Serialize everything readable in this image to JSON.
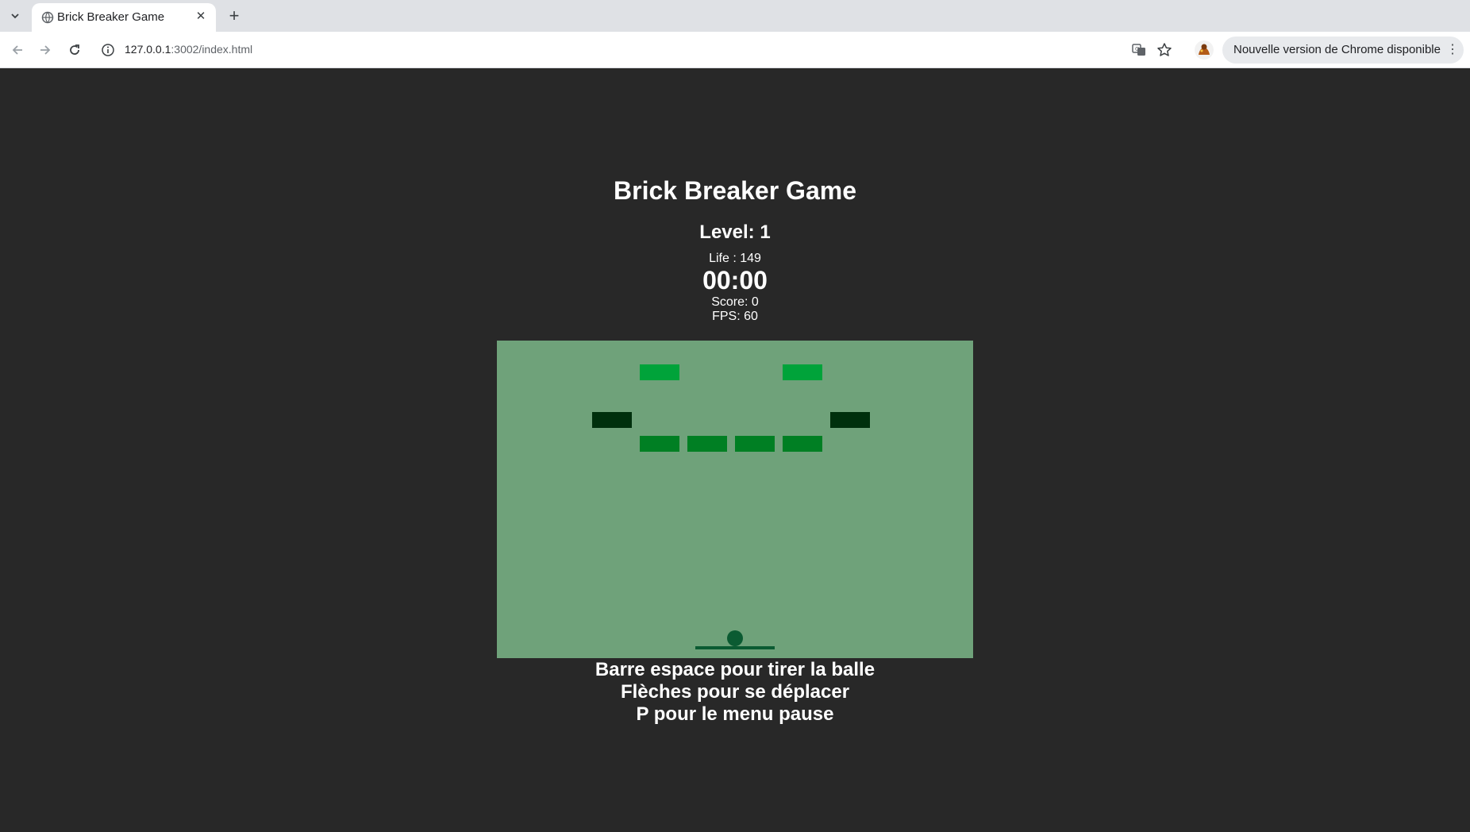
{
  "browser": {
    "tab_title": "Brick Breaker Game",
    "url_host": "127.0.0.1",
    "url_rest": ":3002/index.html",
    "update_label": "Nouvelle version de Chrome disponible"
  },
  "game": {
    "title": "Brick Breaker Game",
    "level": "Level: 1",
    "life": "Life : 149",
    "timer": "00:00",
    "score": "Score: 0",
    "fps": "FPS: 60",
    "canvas_color": "#6fa27a",
    "brick_colors": {
      "light": "#00a33a",
      "medium": "#007f23",
      "dark": "#00300d"
    },
    "ball_color": "#0b5b32",
    "paddle_color": "#0b5b32"
  },
  "instructions": [
    "Barre espace pour tirer la balle",
    "Flèches pour se déplacer",
    "P pour le menu pause"
  ]
}
